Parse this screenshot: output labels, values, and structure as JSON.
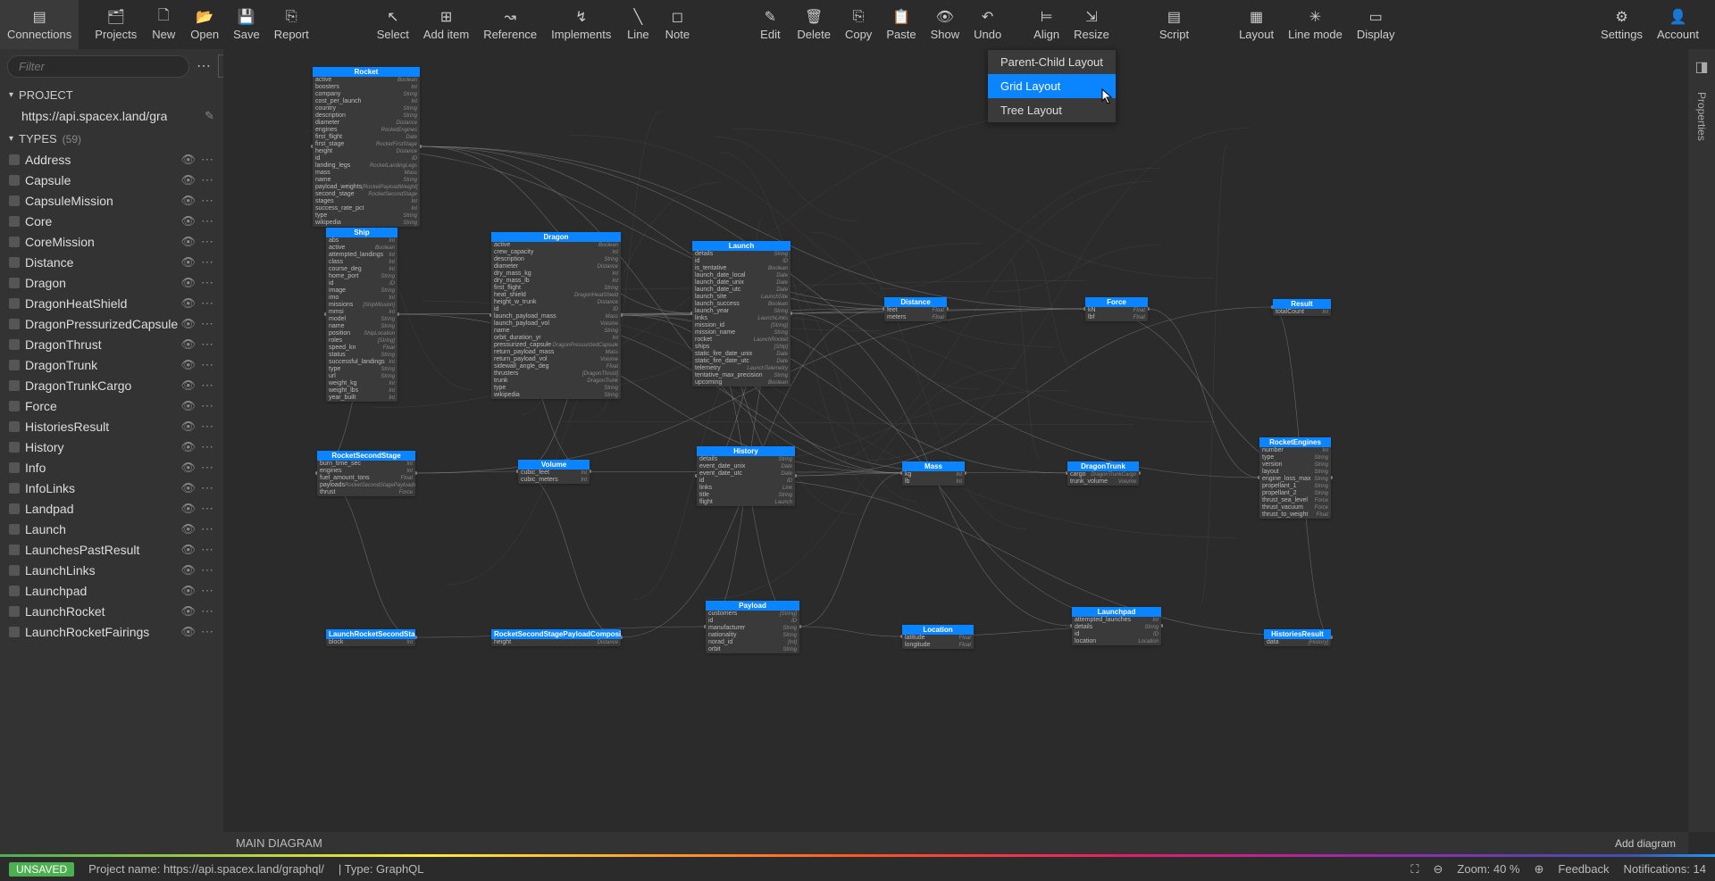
{
  "toolbar": {
    "connections": "Connections",
    "projects": "Projects",
    "new": "New",
    "open": "Open",
    "save": "Save",
    "report": "Report",
    "select": "Select",
    "add_item": "Add item",
    "reference": "Reference",
    "implements": "Implements",
    "line": "Line",
    "note": "Note",
    "edit": "Edit",
    "delete": "Delete",
    "copy": "Copy",
    "paste": "Paste",
    "show": "Show",
    "undo": "Undo",
    "align": "Align",
    "resize": "Resize",
    "script": "Script",
    "layout": "Layout",
    "line_mode": "Line mode",
    "display": "Display",
    "settings": "Settings",
    "account": "Account"
  },
  "sidebar": {
    "filter_placeholder": "Filter",
    "project_label": "PROJECT",
    "project_url": "https://api.spacex.land/gra",
    "types_label": "TYPES",
    "types_count": "(59)",
    "types": [
      "Address",
      "Capsule",
      "CapsuleMission",
      "Core",
      "CoreMission",
      "Distance",
      "Dragon",
      "DragonHeatShield",
      "DragonPressurizedCapsule",
      "DragonThrust",
      "DragonTrunk",
      "DragonTrunkCargo",
      "Force",
      "HistoriesResult",
      "History",
      "Info",
      "InfoLinks",
      "Landpad",
      "Launch",
      "LaunchesPastResult",
      "LaunchLinks",
      "Launchpad",
      "LaunchRocket",
      "LaunchRocketFairings"
    ]
  },
  "dropdown": {
    "items": [
      "Parent-Child Layout",
      "Grid Layout",
      "Tree Layout"
    ],
    "selected": "Grid Layout"
  },
  "right": {
    "properties": "Properties"
  },
  "bottom": {
    "main_diagram": "MAIN DIAGRAM",
    "add_diagram": "Add diagram"
  },
  "status": {
    "unsaved": "UNSAVED",
    "project_name": "Project name: https://api.spacex.land/graphql/",
    "type": "|   Type: GraphQL",
    "zoom": "Zoom: 40 %",
    "feedback": "Feedback",
    "notifications": "Notifications: 14"
  },
  "nodes": {
    "rocket": {
      "title": "Rocket",
      "fields": [
        [
          "active",
          "Boolean"
        ],
        [
          "boosters",
          "Int"
        ],
        [
          "company",
          "String"
        ],
        [
          "cost_per_launch",
          "Int"
        ],
        [
          "country",
          "String"
        ],
        [
          "description",
          "String"
        ],
        [
          "diameter",
          "Distance"
        ],
        [
          "engines",
          "RocketEngines"
        ],
        [
          "first_flight",
          "Date"
        ],
        [
          "first_stage",
          "RocketFirstStage"
        ],
        [
          "height",
          "Distance"
        ],
        [
          "id",
          "ID"
        ],
        [
          "landing_legs",
          "RocketLandingLegs"
        ],
        [
          "mass",
          "Mass"
        ],
        [
          "name",
          "String"
        ],
        [
          "payload_weights",
          "[RocketPayloadWeight]"
        ],
        [
          "second_stage",
          "RocketSecondStage"
        ],
        [
          "stages",
          "Int"
        ],
        [
          "success_rate_pct",
          "Int"
        ],
        [
          "type",
          "String"
        ],
        [
          "wikipedia",
          "String"
        ]
      ]
    },
    "ship": {
      "title": "Ship",
      "fields": [
        [
          "abs",
          "Int"
        ],
        [
          "active",
          "Boolean"
        ],
        [
          "attempted_landings",
          "Int"
        ],
        [
          "class",
          "Int"
        ],
        [
          "course_deg",
          "Int"
        ],
        [
          "home_port",
          "String"
        ],
        [
          "id",
          "ID"
        ],
        [
          "image",
          "String"
        ],
        [
          "imo",
          "Int"
        ],
        [
          "missions",
          "[ShipMission]"
        ],
        [
          "mmsi",
          "Int"
        ],
        [
          "model",
          "String"
        ],
        [
          "name",
          "String"
        ],
        [
          "position",
          "ShipLocation"
        ],
        [
          "roles",
          "[String]"
        ],
        [
          "speed_kn",
          "Float"
        ],
        [
          "status",
          "String"
        ],
        [
          "successful_landings",
          "Int"
        ],
        [
          "type",
          "String"
        ],
        [
          "url",
          "String"
        ],
        [
          "weight_kg",
          "Int"
        ],
        [
          "weight_lbs",
          "Int"
        ],
        [
          "year_built",
          "Int"
        ]
      ]
    },
    "dragon": {
      "title": "Dragon",
      "fields": [
        [
          "active",
          "Boolean"
        ],
        [
          "crew_capacity",
          "Int"
        ],
        [
          "description",
          "String"
        ],
        [
          "diameter",
          "Distance"
        ],
        [
          "dry_mass_kg",
          "Int"
        ],
        [
          "dry_mass_lb",
          "Int"
        ],
        [
          "first_flight",
          "String"
        ],
        [
          "heat_shield",
          "DragonHeatShield"
        ],
        [
          "height_w_trunk",
          "Distance"
        ],
        [
          "id",
          "ID"
        ],
        [
          "launch_payload_mass",
          "Mass"
        ],
        [
          "launch_payload_vol",
          "Volume"
        ],
        [
          "name",
          "String"
        ],
        [
          "orbit_duration_yr",
          "Int"
        ],
        [
          "pressurized_capsule",
          "DragonPressurizedCapsule"
        ],
        [
          "return_payload_mass",
          "Mass"
        ],
        [
          "return_payload_vol",
          "Volume"
        ],
        [
          "sidewall_angle_deg",
          "Float"
        ],
        [
          "thrusters",
          "[DragonThrust]"
        ],
        [
          "trunk",
          "DragonTrunk"
        ],
        [
          "type",
          "String"
        ],
        [
          "wikipedia",
          "String"
        ]
      ]
    },
    "launch": {
      "title": "Launch",
      "fields": [
        [
          "details",
          "String"
        ],
        [
          "id",
          "ID"
        ],
        [
          "is_tentative",
          "Boolean"
        ],
        [
          "launch_date_local",
          "Date"
        ],
        [
          "launch_date_unix",
          "Date"
        ],
        [
          "launch_date_utc",
          "Date"
        ],
        [
          "launch_site",
          "LaunchSite"
        ],
        [
          "launch_success",
          "Boolean"
        ],
        [
          "launch_year",
          "String"
        ],
        [
          "links",
          "LaunchLinks"
        ],
        [
          "mission_id",
          "[String]"
        ],
        [
          "mission_name",
          "String"
        ],
        [
          "rocket",
          "LaunchRocket"
        ],
        [
          "ships",
          "[Ship]"
        ],
        [
          "static_fire_date_unix",
          "Date"
        ],
        [
          "static_fire_date_utc",
          "Date"
        ],
        [
          "telemetry",
          "LaunchTelemetry"
        ],
        [
          "tentative_max_precision",
          "String"
        ],
        [
          "upcoming",
          "Boolean"
        ]
      ]
    },
    "distance": {
      "title": "Distance",
      "fields": [
        [
          "feet",
          "Float"
        ],
        [
          "meters",
          "Float"
        ]
      ]
    },
    "force": {
      "title": "Force",
      "fields": [
        [
          "kN",
          "Float"
        ],
        [
          "lbf",
          "Float"
        ]
      ]
    },
    "result": {
      "title": "Result",
      "fields": [
        [
          "totalCount",
          "Int"
        ]
      ]
    },
    "rocketsecondstage": {
      "title": "RocketSecondStage",
      "fields": [
        [
          "burn_time_sec",
          "Int"
        ],
        [
          "engines",
          "Int"
        ],
        [
          "fuel_amount_tons",
          "Float"
        ],
        [
          "payloads",
          "RocketSecondStagePayloads"
        ],
        [
          "thrust",
          "Force"
        ]
      ]
    },
    "volume": {
      "title": "Volume",
      "fields": [
        [
          "cubic_feet",
          "Int"
        ],
        [
          "cubic_meters",
          "Int"
        ]
      ]
    },
    "history": {
      "title": "History",
      "fields": [
        [
          "details",
          "String"
        ],
        [
          "event_date_unix",
          "Date"
        ],
        [
          "event_date_utc",
          "Date"
        ],
        [
          "id",
          "ID"
        ],
        [
          "links",
          "Link"
        ],
        [
          "title",
          "String"
        ],
        [
          "flight",
          "Launch"
        ]
      ]
    },
    "mass": {
      "title": "Mass",
      "fields": [
        [
          "kg",
          "Int"
        ],
        [
          "lb",
          "Int"
        ]
      ]
    },
    "dragontrunk": {
      "title": "DragonTrunk",
      "fields": [
        [
          "cargo",
          "DragonTrunkCargo"
        ],
        [
          "trunk_volume",
          "Volume"
        ]
      ]
    },
    "rocketengines": {
      "title": "RocketEngines",
      "fields": [
        [
          "number",
          "Int"
        ],
        [
          "type",
          "String"
        ],
        [
          "version",
          "String"
        ],
        [
          "layout",
          "String"
        ],
        [
          "engine_loss_max",
          "String"
        ],
        [
          "propellant_1",
          "String"
        ],
        [
          "propellant_2",
          "String"
        ],
        [
          "thrust_sea_level",
          "Force"
        ],
        [
          "thrust_vacuum",
          "Force"
        ],
        [
          "thrust_to_weight",
          "Float"
        ]
      ]
    },
    "payload": {
      "title": "Payload",
      "fields": [
        [
          "customers",
          "[String]"
        ],
        [
          "id",
          "ID"
        ],
        [
          "manufacturer",
          "String"
        ],
        [
          "nationality",
          "String"
        ],
        [
          "norad_id",
          "[Int]"
        ],
        [
          "orbit",
          "String"
        ]
      ]
    },
    "location": {
      "title": "Location",
      "fields": [
        [
          "latitude",
          "Float"
        ],
        [
          "longitude",
          "Float"
        ]
      ]
    },
    "launchpad": {
      "title": "Launchpad",
      "fields": [
        [
          "attempted_launches",
          "Int"
        ],
        [
          "details",
          "String"
        ],
        [
          "id",
          "ID"
        ],
        [
          "location",
          "Location"
        ]
      ]
    },
    "historiesresult": {
      "title": "HistoriesResult",
      "fields": [
        [
          "data",
          "[History]"
        ]
      ]
    },
    "launchrocketsecondstage": {
      "title": "LaunchRocketSecondStage",
      "fields": [
        [
          "block",
          "Int"
        ]
      ]
    },
    "rocketsecondstagepayloadcompositefairing": {
      "title": "RocketSecondStagePayloadCompositeFairing",
      "fields": [
        [
          "height",
          "Distance"
        ]
      ]
    }
  }
}
